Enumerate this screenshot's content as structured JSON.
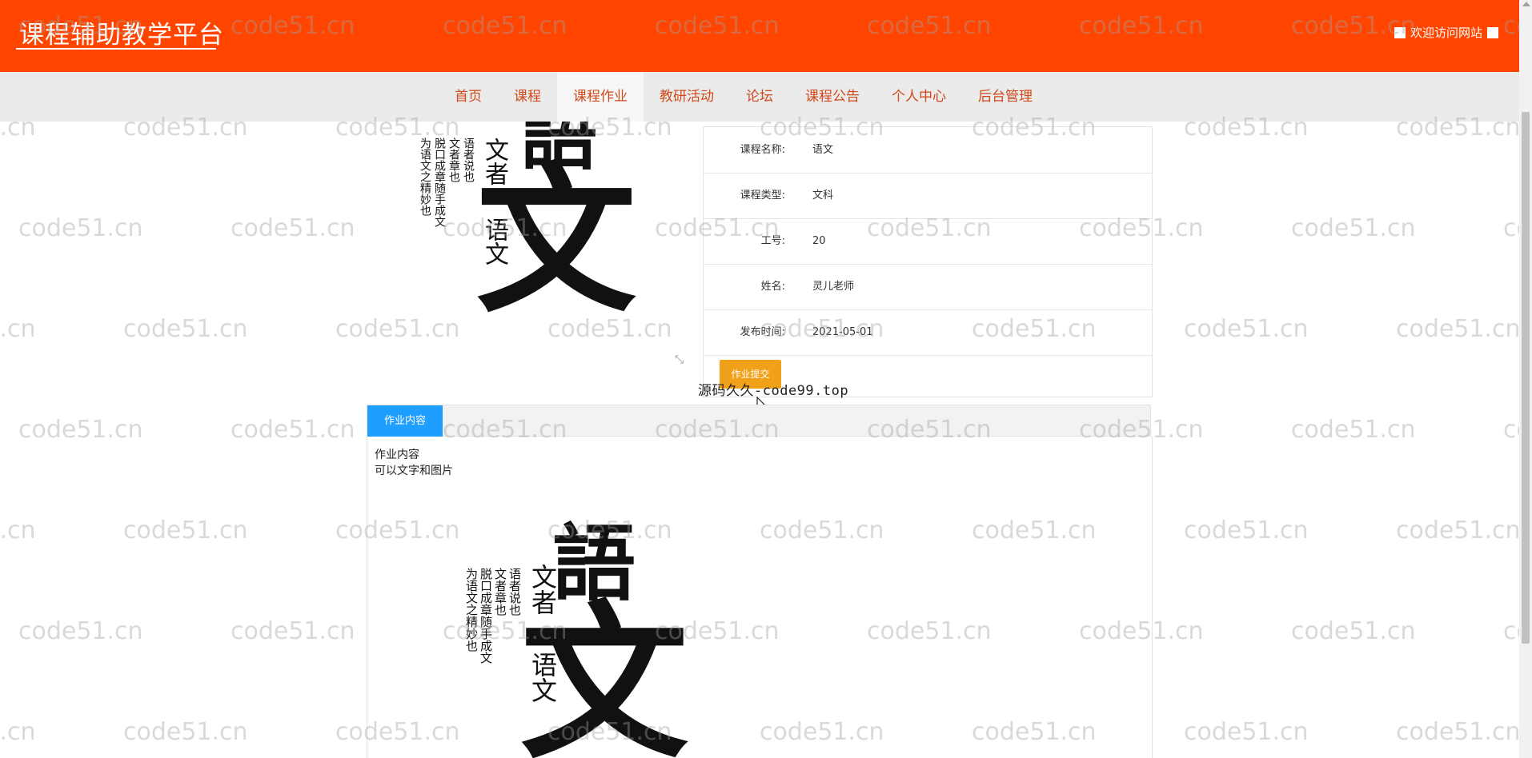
{
  "header": {
    "site_title": "课程辅助教学平台",
    "welcome_text": "欢迎访问网站"
  },
  "nav": {
    "items": [
      {
        "label": "首页"
      },
      {
        "label": "课程"
      },
      {
        "label": "课程作业",
        "active": true
      },
      {
        "label": "教研活动"
      },
      {
        "label": "论坛"
      },
      {
        "label": "课程公告"
      },
      {
        "label": "个人中心"
      },
      {
        "label": "后台管理"
      }
    ]
  },
  "hero_image": {
    "big_char_top": "語",
    "big_char_bottom": "文",
    "side_text_1": "文者",
    "side_text_2": "语文",
    "col_1": "语者说也",
    "col_2": "文者章也",
    "col_3": "脱口成章随手成文",
    "col_4": "为语文之精妙也"
  },
  "detail": {
    "rows": [
      {
        "label": "课程名称:",
        "value": "语文"
      },
      {
        "label": "课程类型:",
        "value": "文科"
      },
      {
        "label": "工号:",
        "value": "20"
      },
      {
        "label": "姓名:",
        "value": "灵儿老师"
      },
      {
        "label": "发布时间:",
        "value": "2021-05-01"
      }
    ],
    "submit_label": "作业提交"
  },
  "overlay_text": "源码久久-code99.top",
  "tabs": {
    "active_label": "作业内容"
  },
  "content": {
    "line_1": "作业内容",
    "line_2": "可以文字和图片"
  },
  "watermark_text": "code51.cn",
  "colors": {
    "header_bg": "#ff4500",
    "nav_text": "#d0491a",
    "submit_btn": "#f0a019",
    "tab_active": "#1e9fff"
  }
}
